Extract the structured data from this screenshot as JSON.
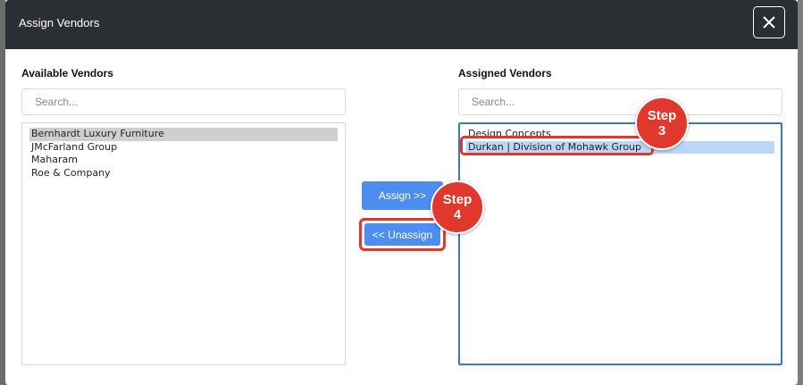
{
  "dialog": {
    "title": "Assign Vendors",
    "close_icon": "close-icon"
  },
  "available": {
    "label": "Available Vendors",
    "search_placeholder": "Search...",
    "items": [
      {
        "label": "Bernhardt Luxury Furniture",
        "selected": true
      },
      {
        "label": "JMcFarland Group",
        "selected": false
      },
      {
        "label": "Maharam",
        "selected": false
      },
      {
        "label": "Roe & Company",
        "selected": false
      }
    ]
  },
  "assigned": {
    "label": "Assigned Vendors",
    "search_placeholder": "Search...",
    "items": [
      {
        "label": "Design Concepts",
        "selected": false
      },
      {
        "label": "Durkan | Division of Mohawk Group",
        "selected": true
      }
    ]
  },
  "actions": {
    "assign_label": "Assign >>",
    "unassign_label": "<< Unassign"
  },
  "annotations": {
    "step3": {
      "line1": "Step",
      "line2": "3"
    },
    "step4": {
      "line1": "Step",
      "line2": "4"
    },
    "highlight_color": "#e0382d"
  },
  "colors": {
    "header_bg": "#2b2f33",
    "button_bg": "#4d8df0",
    "list_focus_border": "#3a78c9",
    "selected_blue": "#bcd6f7",
    "selected_gray": "#cfcfcf"
  }
}
